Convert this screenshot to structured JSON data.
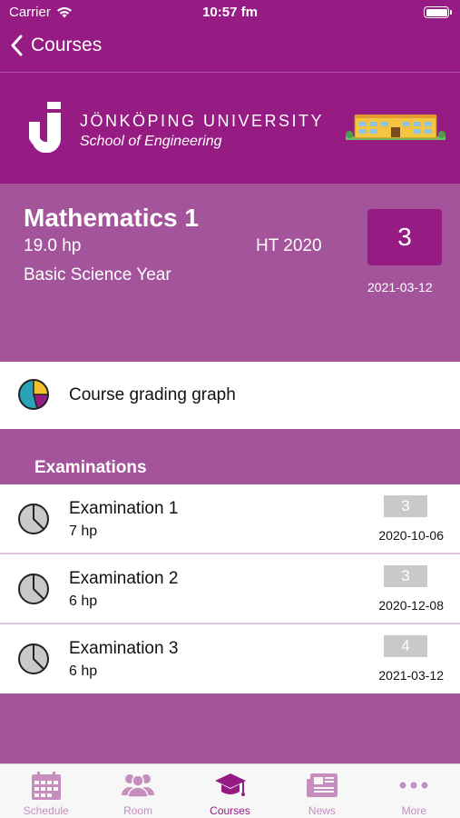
{
  "status_bar": {
    "carrier": "Carrier",
    "time": "10:57 fm"
  },
  "nav": {
    "back_label": "Courses"
  },
  "banner": {
    "university": "JÖNKÖPING UNIVERSITY",
    "school": "School of Engineering"
  },
  "course": {
    "name": "Mathematics 1",
    "credits": "19.0  hp",
    "term": "HT 2020",
    "program": "Basic Science Year",
    "grade": "3",
    "grade_date": "2021-03-12"
  },
  "grading_graph": {
    "label": "Course grading graph"
  },
  "examinations": {
    "title": "Examinations",
    "items": [
      {
        "name": "Examination 1",
        "credits": "7  hp",
        "grade": "3",
        "date": "2020-10-06"
      },
      {
        "name": "Examination 2",
        "credits": "6  hp",
        "grade": "3",
        "date": "2020-12-08"
      },
      {
        "name": "Examination 3",
        "credits": "6  hp",
        "grade": "4",
        "date": "2021-03-12"
      }
    ]
  },
  "tabbar": {
    "items": [
      {
        "label": "Schedule",
        "icon": "calendar-icon"
      },
      {
        "label": "Room",
        "icon": "people-icon"
      },
      {
        "label": "Courses",
        "icon": "graduation-cap-icon"
      },
      {
        "label": "News",
        "icon": "newspaper-icon"
      },
      {
        "label": "More",
        "icon": "more-dots-icon"
      }
    ],
    "active_index": 2
  },
  "colors": {
    "brand_purple": "#961c83",
    "section_purple": "#a4549b",
    "tab_inactive": "#c58ebc",
    "badge_gray": "#c9c9c9"
  }
}
